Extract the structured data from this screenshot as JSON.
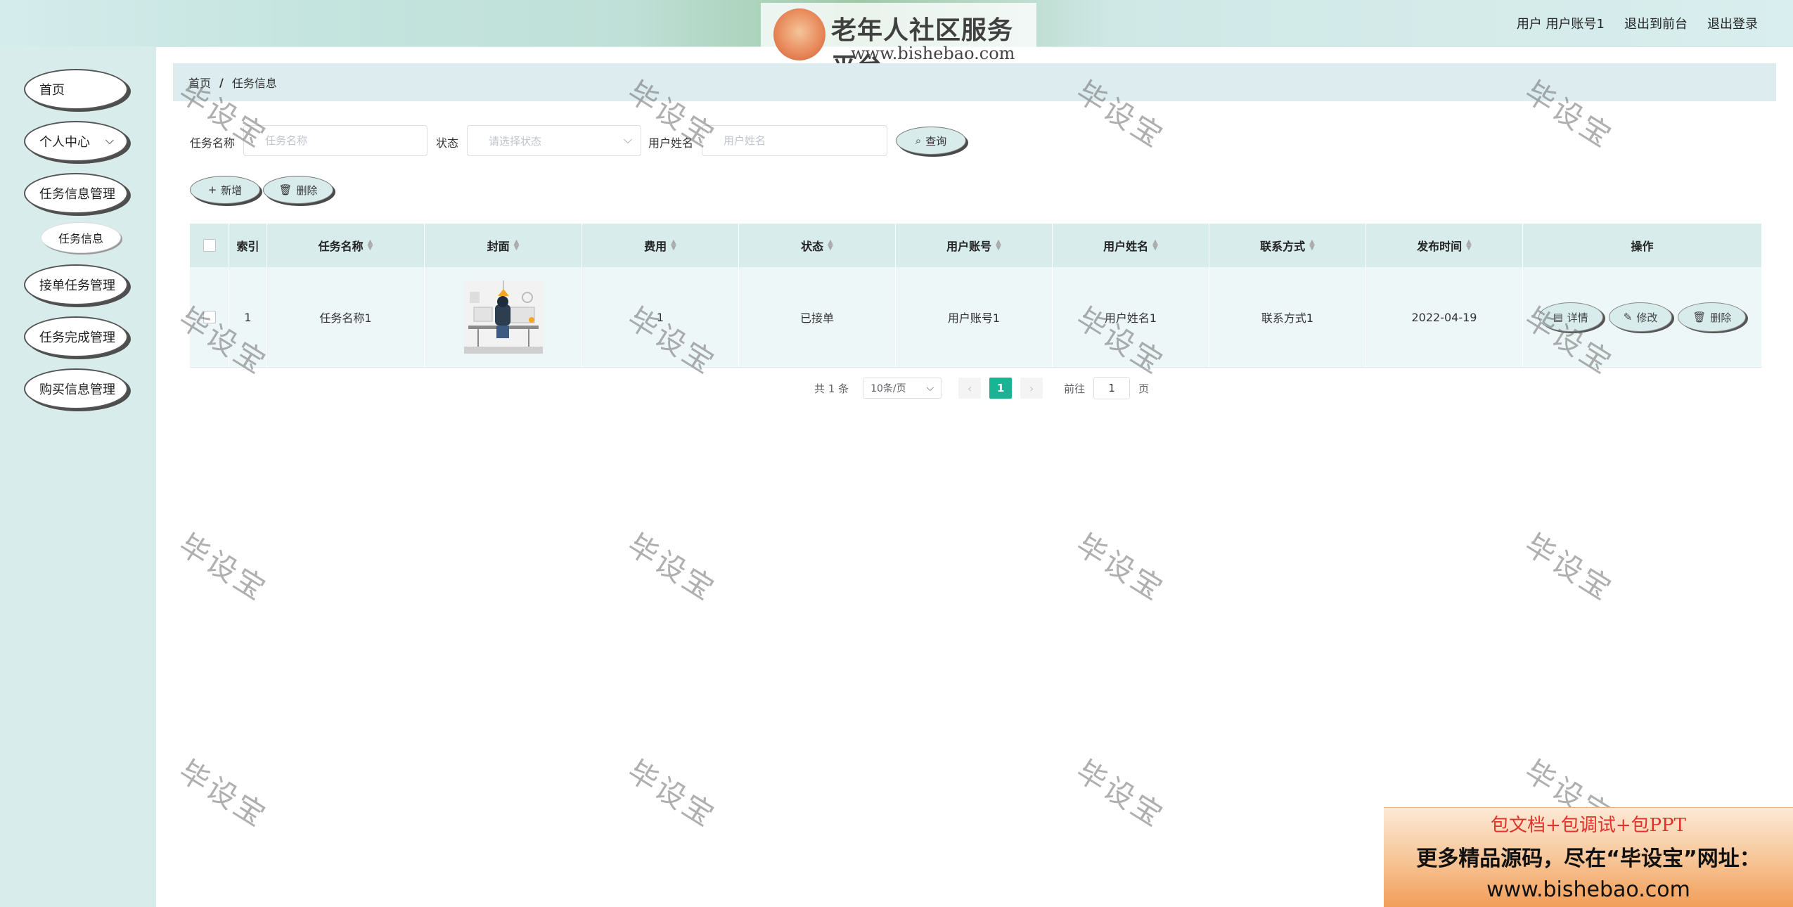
{
  "header": {
    "logo_title": "老年人社区服务平台",
    "logo_sub": "www.bishebao.com",
    "user_text": "用户 用户账号1",
    "back_front": "退出到前台",
    "logout": "退出登录"
  },
  "sidebar": {
    "items": [
      {
        "label": "首页"
      },
      {
        "label": "个人中心"
      },
      {
        "label": "任务信息管理"
      },
      {
        "label": "接单任务管理"
      },
      {
        "label": "任务完成管理"
      },
      {
        "label": "购买信息管理"
      }
    ],
    "sub_item": "任务信息"
  },
  "breadcrumb": {
    "home": "首页",
    "sep": "/",
    "current": "任务信息"
  },
  "filters": {
    "task_name_label": "任务名称",
    "task_name_placeholder": "任务名称",
    "status_label": "状态",
    "status_placeholder": "请选择状态",
    "user_name_label": "用户姓名",
    "user_name_placeholder": "用户姓名",
    "search_btn": "查询"
  },
  "actions": {
    "add": "新增",
    "delete": "删除"
  },
  "table": {
    "headers": [
      "索引",
      "任务名称",
      "封面",
      "费用",
      "状态",
      "用户账号",
      "用户姓名",
      "联系方式",
      "发布时间",
      "操作"
    ],
    "rows": [
      {
        "index": "1",
        "task_name": "任务名称1",
        "fee": "1",
        "status": "已接单",
        "account": "用户账号1",
        "user_name": "用户姓名1",
        "contact": "联系方式1",
        "publish_time": "2022-04-19"
      }
    ],
    "row_actions": {
      "detail": "详情",
      "edit": "修改",
      "delete": "删除"
    }
  },
  "pagination": {
    "total": "共 1 条",
    "page_size": "10条/页",
    "current_page": "1",
    "goto_label": "前往",
    "goto_value": "1",
    "page_unit": "页"
  },
  "watermark": "毕设宝",
  "ad": {
    "line1": "包文档+包调试+包PPT",
    "line2": "更多精品源码，尽在“毕设宝”网址：",
    "line3": "www.bishebao.com"
  },
  "colors": {
    "accent": "#1ab394",
    "sidebar_bg": "#d8ecec"
  }
}
